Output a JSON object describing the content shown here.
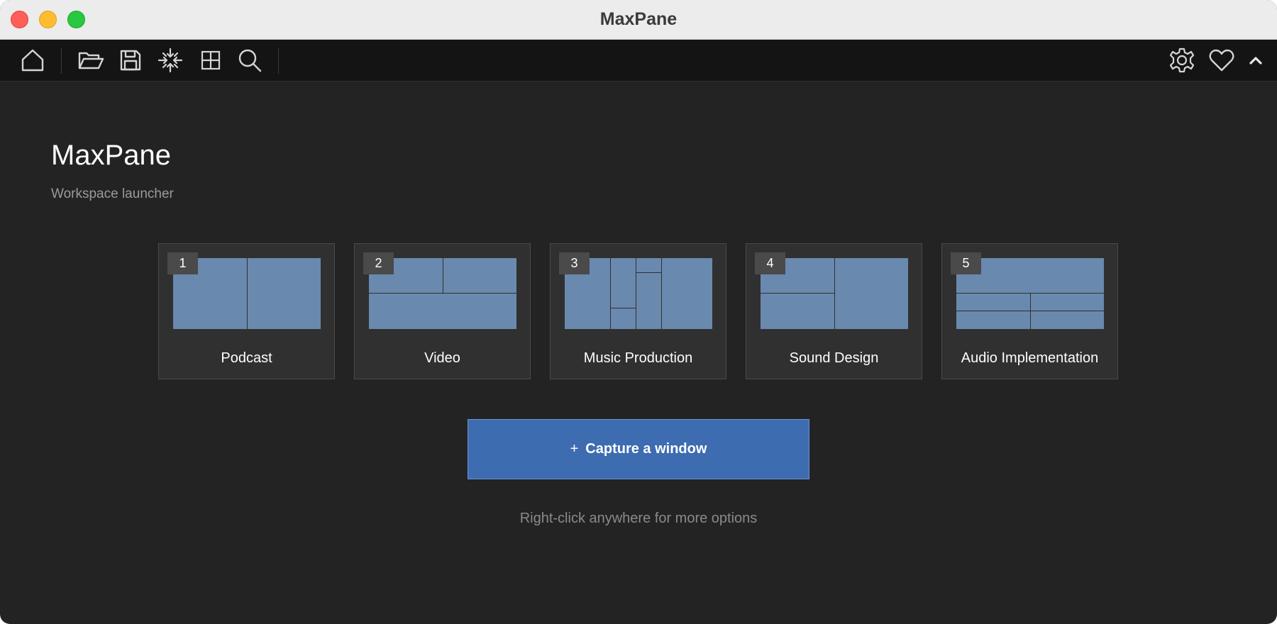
{
  "window": {
    "title": "MaxPane"
  },
  "toolbar": {
    "left_icons": [
      "home-icon",
      "folder-open-icon",
      "save-icon",
      "collapse-icon",
      "grid-icon",
      "search-icon"
    ],
    "right_icons": [
      "gear-icon",
      "heart-icon",
      "chevron-up-icon"
    ]
  },
  "header": {
    "title": "MaxPane",
    "subtitle": "Workspace launcher"
  },
  "workspaces": [
    {
      "number": "1",
      "label": "Podcast"
    },
    {
      "number": "2",
      "label": "Video"
    },
    {
      "number": "3",
      "label": "Music Production"
    },
    {
      "number": "4",
      "label": "Sound Design"
    },
    {
      "number": "5",
      "label": "Audio Implementation"
    }
  ],
  "capture": {
    "icon": "+",
    "label": "Capture a window"
  },
  "hint": "Right-click anywhere for more options",
  "colors": {
    "pane_fill": "#6a89ae",
    "accent": "#3d6cb0",
    "background": "#232323"
  }
}
